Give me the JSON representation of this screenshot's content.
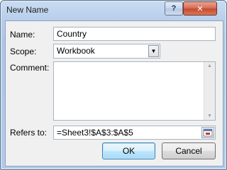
{
  "window": {
    "title": "New Name",
    "help_label": "?",
    "close_label": "✕"
  },
  "form": {
    "name_label": "Name:",
    "name_value": "Country",
    "scope_label": "Scope:",
    "scope_value": "Workbook",
    "comment_label": "Comment:",
    "comment_value": "",
    "refers_label": "Refers to:",
    "refers_value": "=Sheet3!$A$3:$A$5"
  },
  "buttons": {
    "ok": "OK",
    "cancel": "Cancel"
  }
}
